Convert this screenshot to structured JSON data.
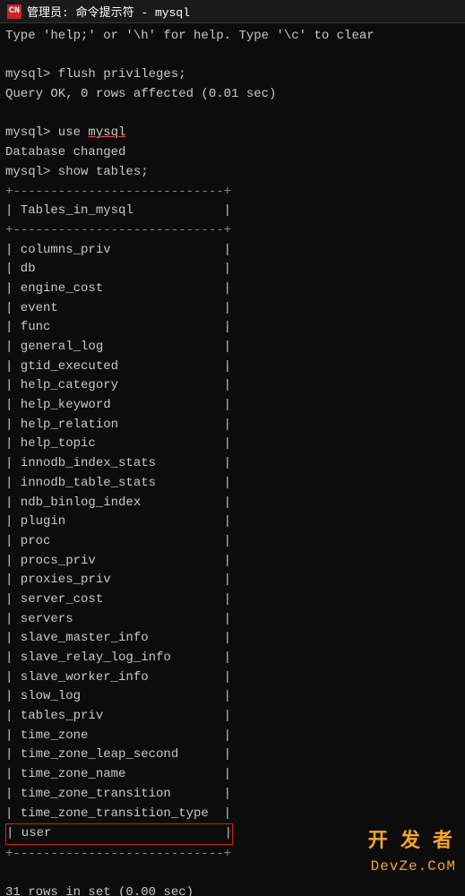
{
  "titleBar": {
    "icon": "CN",
    "title": "管理员: 命令提示符 - mysql"
  },
  "terminal": {
    "lines": [
      {
        "type": "normal",
        "text": "Type 'help;' or '\\h' for help. Type '\\c' to clear"
      },
      {
        "type": "blank",
        "text": ""
      },
      {
        "type": "normal",
        "text": "mysql> flush privileges;"
      },
      {
        "type": "normal",
        "text": "Query OK, 0 rows affected (0.01 sec)"
      },
      {
        "type": "blank",
        "text": ""
      },
      {
        "type": "command-use",
        "prefix": "mysql> use ",
        "cmd": "mysql",
        "underline": true
      },
      {
        "type": "highlighted",
        "text": "Database changed"
      },
      {
        "type": "normal",
        "text": "mysql> show tables;"
      },
      {
        "type": "table-border",
        "text": "+----------------------------+"
      },
      {
        "type": "table-header",
        "text": "| Tables_in_mysql            |"
      },
      {
        "type": "table-border",
        "text": "+----------------------------+"
      },
      {
        "type": "table-row",
        "text": "| columns_priv               |"
      },
      {
        "type": "table-row",
        "text": "| db                         |"
      },
      {
        "type": "table-row",
        "text": "| engine_cost                |"
      },
      {
        "type": "table-row",
        "text": "| event                      |"
      },
      {
        "type": "table-row",
        "text": "| func                       |"
      },
      {
        "type": "table-row",
        "text": "| general_log                |"
      },
      {
        "type": "table-row",
        "text": "| gtid_executed              |"
      },
      {
        "type": "table-row",
        "text": "| help_category              |"
      },
      {
        "type": "table-row",
        "text": "| help_keyword               |"
      },
      {
        "type": "table-row",
        "text": "| help_relation              |"
      },
      {
        "type": "table-row",
        "text": "| help_topic                 |"
      },
      {
        "type": "table-row",
        "text": "| innodb_index_stats         |"
      },
      {
        "type": "table-row",
        "text": "| innodb_table_stats         |"
      },
      {
        "type": "table-row",
        "text": "| ndb_binlog_index           |"
      },
      {
        "type": "table-row",
        "text": "| plugin                     |"
      },
      {
        "type": "table-row",
        "text": "| proc                       |"
      },
      {
        "type": "table-row",
        "text": "| procs_priv                 |"
      },
      {
        "type": "table-row",
        "text": "| proxies_priv               |"
      },
      {
        "type": "table-row",
        "text": "| server_cost                |"
      },
      {
        "type": "table-row",
        "text": "| servers                    |"
      },
      {
        "type": "table-row",
        "text": "| slave_master_info          |"
      },
      {
        "type": "table-row",
        "text": "| slave_relay_log_info       |"
      },
      {
        "type": "table-row",
        "text": "| slave_worker_info          |"
      },
      {
        "type": "table-row",
        "text": "| slow_log                   |"
      },
      {
        "type": "table-row",
        "text": "| tables_priv                |"
      },
      {
        "type": "table-row",
        "text": "| time_zone                  |"
      },
      {
        "type": "table-row",
        "text": "| time_zone_leap_second      |"
      },
      {
        "type": "table-row",
        "text": "| time_zone_name             |"
      },
      {
        "type": "table-row",
        "text": "| time_zone_transition       |"
      },
      {
        "type": "table-row",
        "text": "| time_zone_transition_type  |"
      },
      {
        "type": "table-row-highlighted",
        "text": "| user                       |"
      },
      {
        "type": "table-border",
        "text": "+----------------------------+"
      },
      {
        "type": "blank",
        "text": ""
      },
      {
        "type": "normal",
        "text": "31 rows in set (0.00 sec)"
      },
      {
        "type": "blank",
        "text": ""
      }
    ],
    "watermark": {
      "line1": "开 发 者",
      "line2": "DevZe.CoM"
    }
  }
}
